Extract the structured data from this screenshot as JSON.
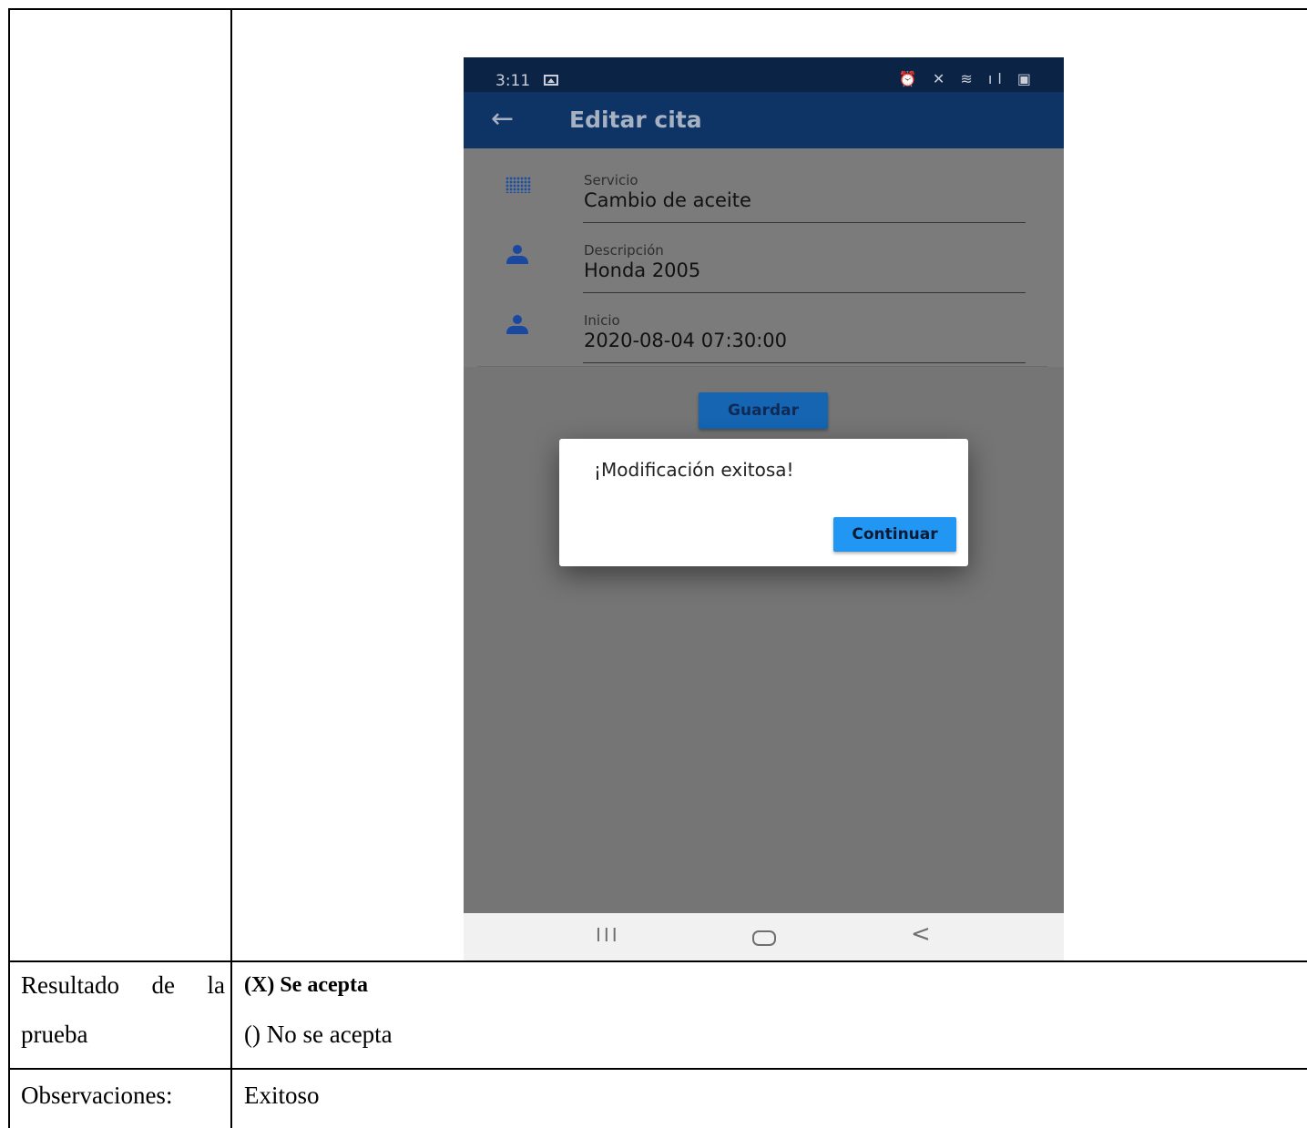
{
  "document": {
    "result_label_left": "Resultado de la",
    "result_label_second_line": "prueba",
    "result_accepted": "(X) Se acepta",
    "result_rejected": "() No se acepta",
    "observations_label": "Observaciones:",
    "observations_value": "Exitoso"
  },
  "phone": {
    "status": {
      "time": "3:11",
      "icons": "⏰ ✕ ≋ ıl ▣"
    },
    "appbar": {
      "back_icon": "←",
      "title": "Editar cita"
    },
    "fields": [
      {
        "icon": "grid-dots-icon",
        "label": "Servicio",
        "value": "Cambio de aceite"
      },
      {
        "icon": "person-icon",
        "label": "Descripción",
        "value": "Honda 2005"
      },
      {
        "icon": "person-icon",
        "label": "Inicio",
        "value": "2020-08-04 07:30:00"
      }
    ],
    "save_button": "Guardar",
    "dialog": {
      "message": "¡Modificación exitosa!",
      "button": "Continuar"
    },
    "navbar": {
      "recent": "III",
      "back": "<"
    }
  },
  "colors": {
    "status_bar": "#0b2345",
    "app_bar": "#0e3466",
    "overlay": "#757575",
    "primary_button": "#1565b2",
    "dialog_button": "#2196f3"
  }
}
